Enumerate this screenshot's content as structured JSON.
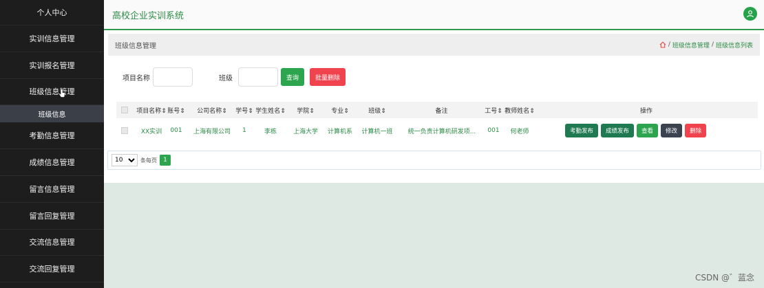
{
  "sidebar": {
    "top": "个人中心",
    "items": [
      "实训信息管理",
      "实训报名管理",
      "班级信息管理",
      "考勤信息管理",
      "成绩信息管理",
      "留言信息管理",
      "留言回复管理",
      "交流信息管理",
      "交流回复管理"
    ],
    "sub_active": "班级信息"
  },
  "header": {
    "title": "高校企业实训系统",
    "user_icon": "user-icon"
  },
  "breadcrumb": {
    "page": "班级信息管理",
    "path1": "班级信息管理",
    "sep": "/",
    "path2": "班级信息列表"
  },
  "search": {
    "project_label": "项目名称",
    "class_label": "班级",
    "query_btn": "查询",
    "batch_delete_btn": "批量删除"
  },
  "table": {
    "headers": [
      "项目名称⇕",
      "账号⇕",
      "公司名称⇕",
      "学号⇕",
      "学生姓名⇕",
      "学院⇕",
      "专业⇕",
      "班级⇕",
      "备注",
      "工号⇕",
      "教师姓名⇕",
      "操作"
    ],
    "rows": [
      [
        "XX实训",
        "001",
        "上海有限公司",
        "1",
        "李栋",
        "上海大学",
        "计算机系",
        "计算机一班",
        "统一负责计算机研发项...",
        "001",
        "何老师"
      ]
    ],
    "ops": [
      "考勤发布",
      "成绩发布",
      "查看",
      "修改",
      "删除"
    ]
  },
  "pager": {
    "size": "10",
    "per_page_label": "条每页",
    "current": "1"
  },
  "watermark": "CSDN @゛蓝念",
  "colors": {
    "accent": "#2da44e",
    "danger": "#f0434d",
    "sidebar": "#1d1d1d"
  }
}
